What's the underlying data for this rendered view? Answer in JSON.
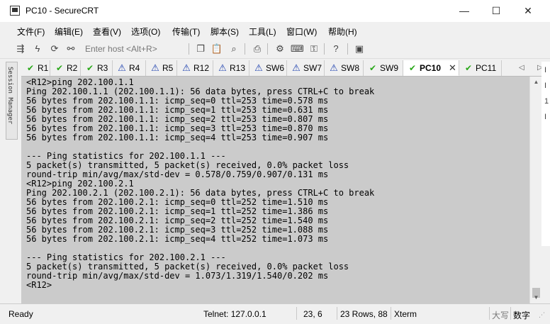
{
  "window": {
    "title": "PC10 - SecureCRT",
    "minimize": "—",
    "maximize": "☐",
    "close": "✕"
  },
  "menu": [
    "文件(F)",
    "编辑(E)",
    "查看(V)",
    "选项(O)",
    "传输(T)",
    "脚本(S)",
    "工具(L)",
    "窗口(W)",
    "帮助(H)"
  ],
  "toolbar": {
    "host_placeholder": "Enter host <Alt+R>"
  },
  "sidebar": {
    "label": "Session Manager"
  },
  "tabs": [
    {
      "label": "R1",
      "status": "ok"
    },
    {
      "label": "R2",
      "status": "ok"
    },
    {
      "label": "R3",
      "status": "ok"
    },
    {
      "label": "R4",
      "status": "warn"
    },
    {
      "label": "R5",
      "status": "warn"
    },
    {
      "label": "R12",
      "status": "warn"
    },
    {
      "label": "R13",
      "status": "warn"
    },
    {
      "label": "SW6",
      "status": "warn"
    },
    {
      "label": "SW7",
      "status": "warn"
    },
    {
      "label": "SW8",
      "status": "warn"
    },
    {
      "label": "SW9",
      "status": "ok"
    },
    {
      "label": "PC10",
      "status": "ok",
      "active": true
    },
    {
      "label": "PC11",
      "status": "ok"
    }
  ],
  "terminal": {
    "lines": [
      "<R12>ping 202.100.1.1",
      "Ping 202.100.1.1 (202.100.1.1): 56 data bytes, press CTRL+C to break",
      "56 bytes from 202.100.1.1: icmp_seq=0 ttl=253 time=0.578 ms",
      "56 bytes from 202.100.1.1: icmp_seq=1 ttl=253 time=0.631 ms",
      "56 bytes from 202.100.1.1: icmp_seq=2 ttl=253 time=0.807 ms",
      "56 bytes from 202.100.1.1: icmp_seq=3 ttl=253 time=0.870 ms",
      "56 bytes from 202.100.1.1: icmp_seq=4 ttl=253 time=0.907 ms",
      "",
      "--- Ping statistics for 202.100.1.1 ---",
      "5 packet(s) transmitted, 5 packet(s) received, 0.0% packet loss",
      "round-trip min/avg/max/std-dev = 0.578/0.759/0.907/0.131 ms",
      "<R12>ping 202.100.2.1",
      "Ping 202.100.2.1 (202.100.2.1): 56 data bytes, press CTRL+C to break",
      "56 bytes from 202.100.2.1: icmp_seq=0 ttl=252 time=1.510 ms",
      "56 bytes from 202.100.2.1: icmp_seq=1 ttl=252 time=1.386 ms",
      "56 bytes from 202.100.2.1: icmp_seq=2 ttl=252 time=1.540 ms",
      "56 bytes from 202.100.2.1: icmp_seq=3 ttl=252 time=1.088 ms",
      "56 bytes from 202.100.2.1: icmp_seq=4 ttl=252 time=1.073 ms",
      "",
      "--- Ping statistics for 202.100.2.1 ---",
      "5 packet(s) transmitted, 5 packet(s) received, 0.0% packet loss",
      "round-trip min/avg/max/std-dev = 1.073/1.319/1.540/0.202 ms",
      "<R12>"
    ]
  },
  "status": {
    "ready": "Ready",
    "connection": "Telnet: 127.0.0.1",
    "position": "23,   6",
    "size": "23 Rows, 88",
    "emulation": "Xterm",
    "caps": "大写",
    "num": "数字"
  },
  "right_edge_chars": [
    "I",
    "I",
    "1",
    "I"
  ],
  "colors": {
    "ok": "#2aa81a",
    "warn": "#1c3fae",
    "selection": "#cbcbcb"
  }
}
